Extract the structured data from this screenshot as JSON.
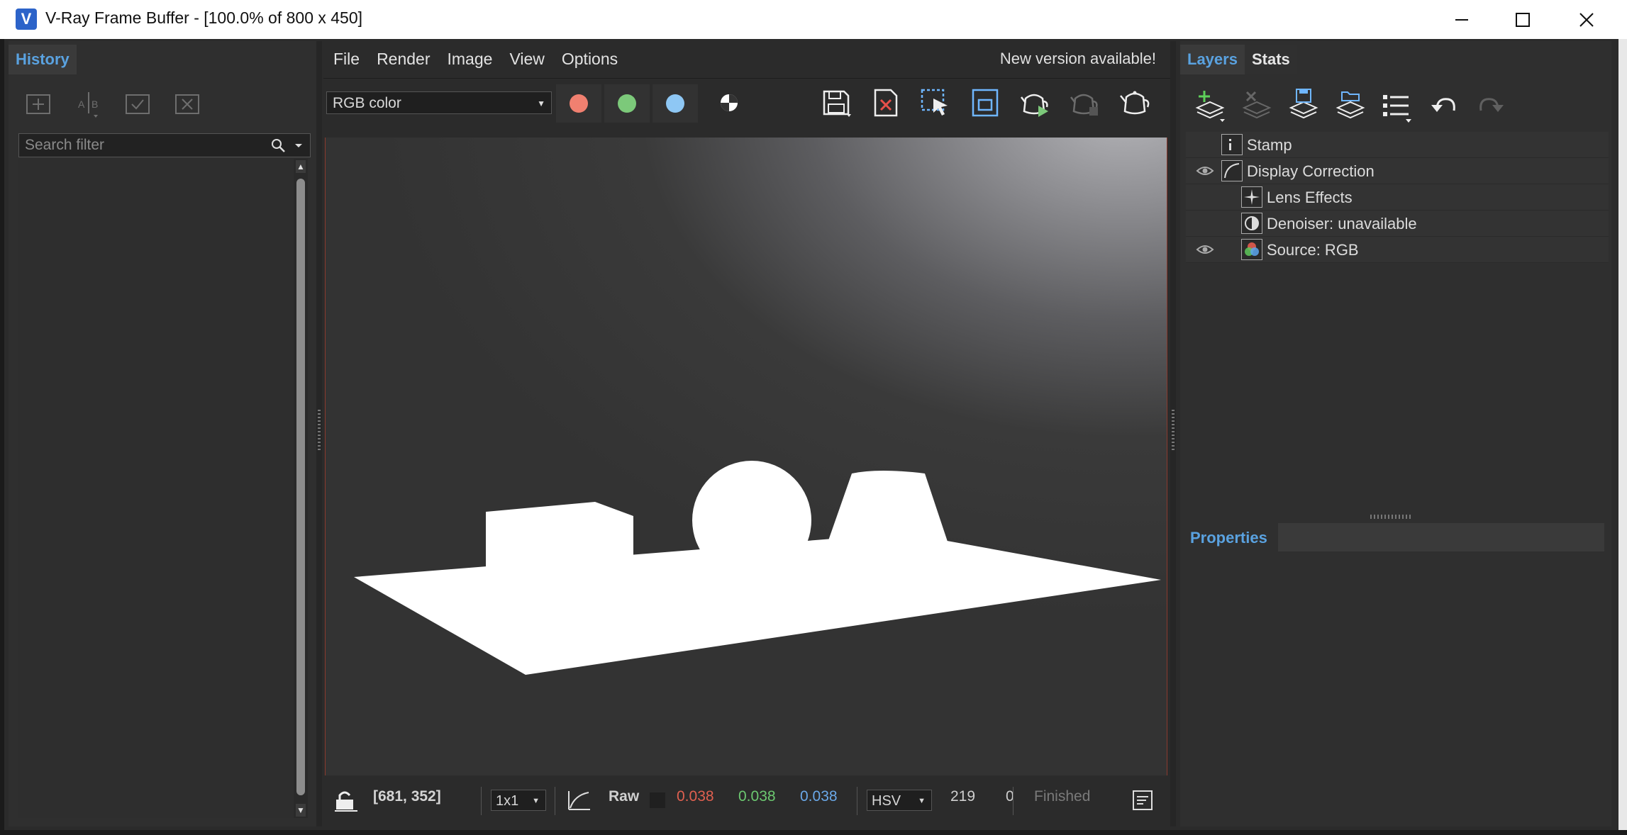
{
  "window": {
    "title": "V-Ray Frame Buffer - [100.0% of 800 x 450]",
    "logo_letter": "V"
  },
  "history": {
    "tab_label": "History",
    "search_placeholder": "Search filter"
  },
  "menu": {
    "items": [
      "File",
      "Render",
      "Image",
      "View",
      "Options"
    ],
    "notice": "New version available!"
  },
  "toolbar": {
    "channel": "RGB color",
    "colors": {
      "red": "#f08070",
      "green": "#7cc97a",
      "blue": "#8ec7f4"
    }
  },
  "status": {
    "coords": "[681, 352]",
    "sample": "1x1",
    "mode": "Raw",
    "r": "0.038",
    "g": "0.038",
    "b": "0.038",
    "color_space": "HSV",
    "value": "219",
    "value2": "0",
    "state": "Finished",
    "colors": {
      "r": "#e06050",
      "g": "#6cc870",
      "b": "#6aa8e8"
    }
  },
  "right_panel": {
    "tabs": [
      "Layers",
      "Stats"
    ],
    "layers": [
      {
        "label": "Stamp",
        "visible": false,
        "indent": 0,
        "icon": "stamp-icon"
      },
      {
        "label": "Display Correction",
        "visible": true,
        "indent": 0,
        "icon": "curve-icon"
      },
      {
        "label": "Lens Effects",
        "visible": false,
        "indent": 1,
        "icon": "lens-effects-icon"
      },
      {
        "label": "Denoiser: unavailable",
        "visible": false,
        "indent": 1,
        "icon": "denoiser-icon"
      },
      {
        "label": "Source: RGB",
        "visible": true,
        "indent": 1,
        "icon": "rgb-source-icon"
      }
    ],
    "properties_label": "Properties"
  }
}
